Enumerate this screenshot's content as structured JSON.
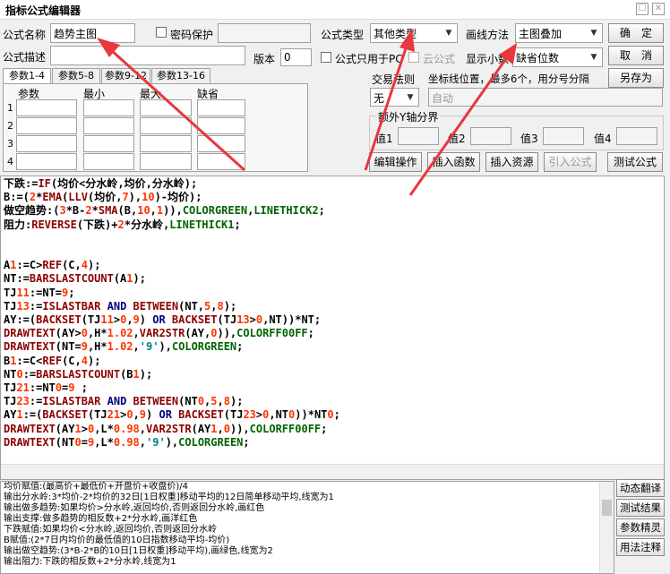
{
  "window": {
    "title": "指标公式编辑器",
    "restore_glyph": "☐",
    "close_glyph": "✕"
  },
  "form": {
    "name_label": "公式名称",
    "name_value": "趋势主图",
    "password_label": "密码保护",
    "type_label": "公式类型",
    "type_value": "其他类型",
    "draw_label": "画线方法",
    "draw_value": "主图叠加",
    "desc_label": "公式描述",
    "desc_value": "",
    "version_label": "版本",
    "version_value": "0",
    "pc_only_label": "公式只用于PC",
    "cloud_label": "云公式",
    "decimals_label": "显示小数",
    "decimals_value": "缺省位数",
    "ok_label": "确　定",
    "cancel_label": "取　消",
    "saveas_label": "另存为"
  },
  "params": {
    "tabs": [
      "参数1-4",
      "参数5-8",
      "参数9-12",
      "参数13-16"
    ],
    "headers": [
      "参数",
      "最小",
      "最大",
      "缺省"
    ],
    "rows": [
      "1",
      "2",
      "3",
      "4"
    ]
  },
  "trade": {
    "rule_label": "交易法则",
    "rule_value": "无",
    "coord_label": "坐标线位置，最多6个，用分号分隔",
    "coord_value": "自动",
    "yaxis_label": "额外Y轴分界",
    "y_labels": [
      "值1",
      "值2",
      "值3",
      "值4"
    ]
  },
  "toolbar": [
    "编辑操作",
    "插入函数",
    "插入资源",
    "引入公式",
    "测试公式"
  ],
  "code_lines": [
    "下跌:=IF(均价<分水岭,均价,分水岭);",
    "B:=(2*EMA(LLV(均价,7),10)-均价);",
    "做空趋势:(3*B-2*SMA(B,10,1)),COLORGREEN,LINETHICK2;",
    "阻力:REVERSE(下跌)+2*分水岭,LINETHICK1;",
    "",
    "",
    "A1:=C>REF(C,4);",
    "NT:=BARSLASTCOUNT(A1);",
    "TJ11:=NT=9;",
    "TJ13:=ISLASTBAR AND BETWEEN(NT,5,8);",
    "AY:=(BACKSET(TJ11>0,9) OR BACKSET(TJ13>0,NT))*NT;",
    "DRAWTEXT(AY>0,H*1.02,VAR2STR(AY,0)),COLORFF00FF;",
    "DRAWTEXT(NT=9,H*1.02,'9'),COLORGREEN;",
    "B1:=C<REF(C,4);",
    "NT0:=BARSLASTCOUNT(B1);",
    "TJ21:=NT0=9 ;",
    "TJ23:=ISLASTBAR AND BETWEEN(NT0,5,8);",
    "AY1:=(BACKSET(TJ21>0,9) OR BACKSET(TJ23>0,NT0))*NT0;",
    "DRAWTEXT(AY1>0,L*0.98,VAR2STR(AY1,0)),COLORFF00FF;",
    "DRAWTEXT(NT0=9,L*0.98,'9'),COLORGREEN;"
  ],
  "output_lines": [
    "均价赋值:(最高价+最低价+开盘价+收盘价)/4",
    "输出分水岭:3*均价-2*均价的32日[1日权重]移动平均的12日简单移动平均,线宽为1",
    "输出做多趋势:如果均价>分水岭,返回均价,否则返回分水岭,画红色",
    "输出支撑:做多趋势的相反数+2*分水岭,画洋红色",
    "下跌赋值:如果均价<分水岭,返回均价,否则返回分水岭",
    "B赋值:(2*7日内均价的最低值的10日指数移动平均-均价)",
    "输出做空趋势:(3*B-2*B的10日[1日权重]移动平均),画绿色,线宽为2",
    "输出阻力:下跌的相反数+2*分水岭,线宽为1"
  ],
  "side_buttons": [
    "动态翻译",
    "测试结果",
    "参数精灵",
    "用法注释"
  ],
  "colors": {
    "annotation_arrow": "#e8383d",
    "function": "#8b0000",
    "number": "#ff3300",
    "color_const": "#006400"
  }
}
